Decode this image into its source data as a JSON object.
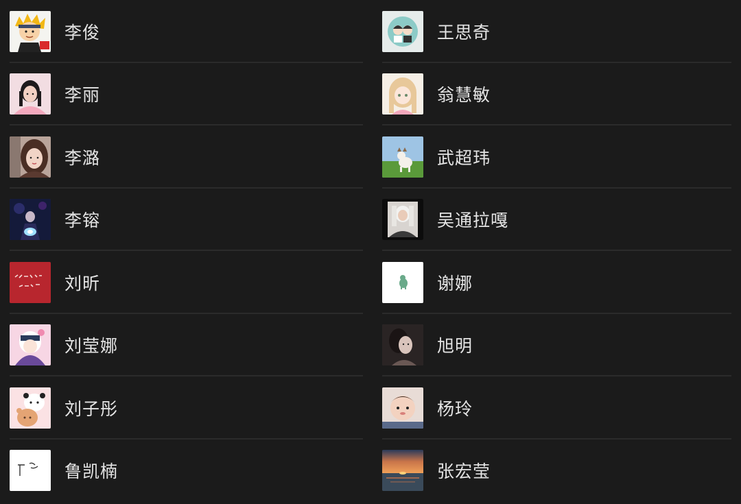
{
  "contacts": {
    "left": [
      {
        "name": "李俊",
        "avatar": "cartoon-boy-avatar-icon"
      },
      {
        "name": "李丽",
        "avatar": "girl-photo-avatar-icon"
      },
      {
        "name": "李潞",
        "avatar": "woman-selfie-avatar-icon"
      },
      {
        "name": "李镕",
        "avatar": "concert-photo-avatar-icon"
      },
      {
        "name": "刘昕",
        "avatar": "red-calligraphy-avatar-icon"
      },
      {
        "name": "刘莹娜",
        "avatar": "anime-girl-avatar-icon"
      },
      {
        "name": "刘子彤",
        "avatar": "panda-bear-avatar-icon"
      },
      {
        "name": "鲁凯楠",
        "avatar": "handwriting-avatar-icon"
      }
    ],
    "right": [
      {
        "name": "王思奇",
        "avatar": "couple-cartoon-avatar-icon"
      },
      {
        "name": "翁慧敏",
        "avatar": "blonde-anime-avatar-icon"
      },
      {
        "name": "武超玮",
        "avatar": "dog-on-grass-avatar-icon"
      },
      {
        "name": "吴通拉嘎",
        "avatar": "portrait-photo-avatar-icon"
      },
      {
        "name": "谢娜",
        "avatar": "green-dinosaur-avatar-icon"
      },
      {
        "name": "旭明",
        "avatar": "dark-portrait-avatar-icon"
      },
      {
        "name": "杨玲",
        "avatar": "baby-photo-avatar-icon"
      },
      {
        "name": "张宏莹",
        "avatar": "sunset-avatar-icon"
      }
    ]
  }
}
